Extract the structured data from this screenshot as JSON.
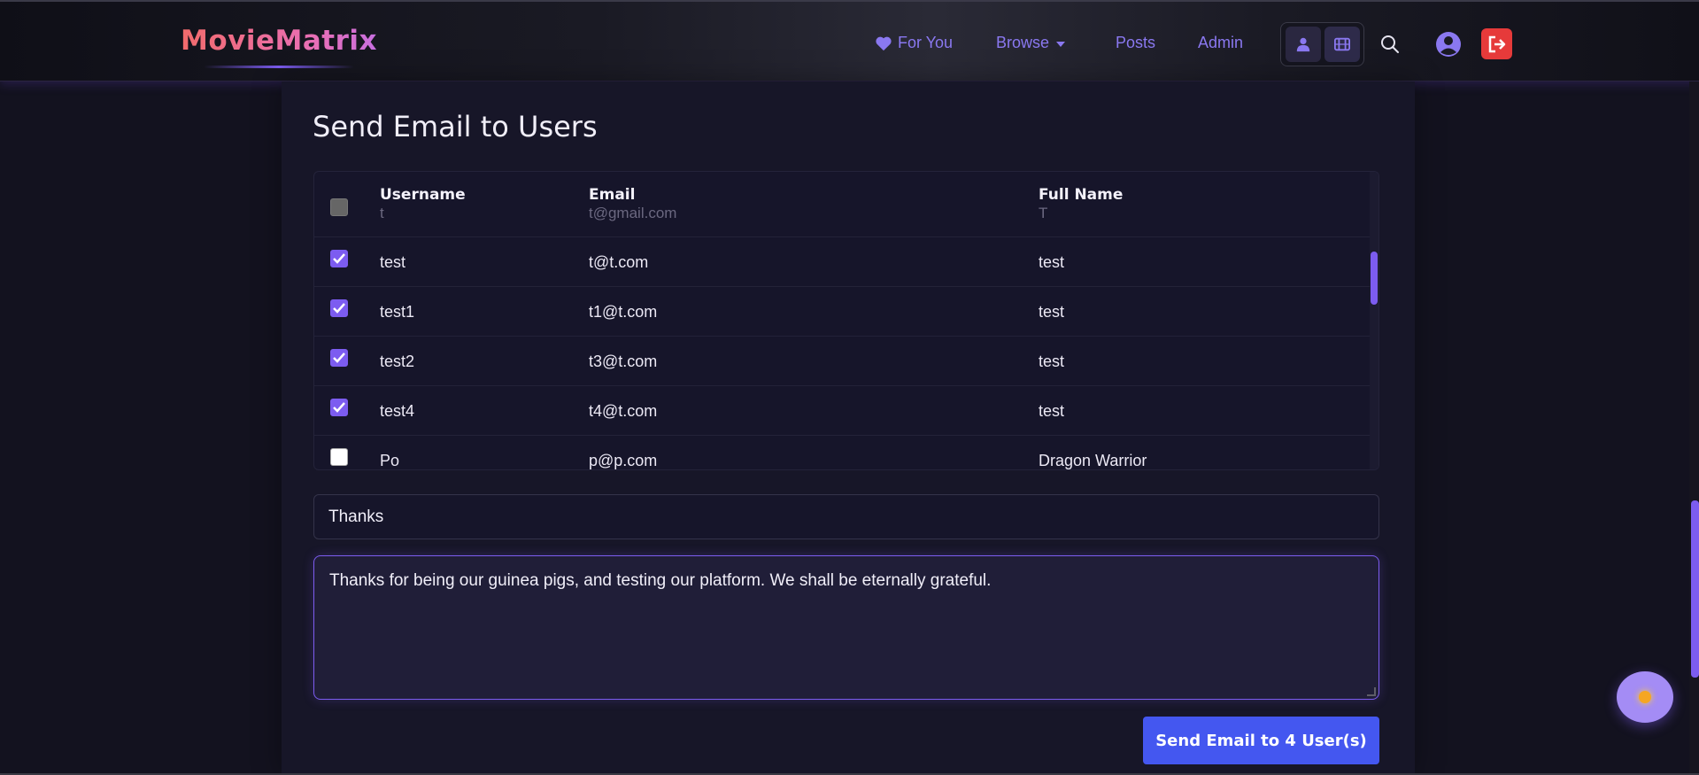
{
  "app": {
    "logo": "MovieMatrix"
  },
  "nav": {
    "for_you": "For You",
    "browse": "Browse",
    "posts": "Posts",
    "admin": "Admin"
  },
  "page": {
    "title": "Send Email to Users"
  },
  "table": {
    "headers": {
      "username": "Username",
      "email": "Email",
      "full_name": "Full Name"
    },
    "filters": {
      "username": "t",
      "email": "t@gmail.com",
      "full_name": "T"
    },
    "rows": [
      {
        "checked": true,
        "username": "test",
        "email": "t@t.com",
        "full_name": "test"
      },
      {
        "checked": true,
        "username": "test1",
        "email": "t1@t.com",
        "full_name": "test"
      },
      {
        "checked": true,
        "username": "test2",
        "email": "t3@t.com",
        "full_name": "test"
      },
      {
        "checked": true,
        "username": "test4",
        "email": "t4@t.com",
        "full_name": "test"
      },
      {
        "checked": false,
        "username": "Po",
        "email": "p@p.com",
        "full_name": "Dragon Warrior"
      }
    ]
  },
  "form": {
    "subject": "Thanks",
    "message": "Thanks for being our guinea pigs, and testing our platform. We shall be eternally grateful.",
    "send_label": "Send Email to 4 User(s)"
  },
  "colors": {
    "accent": "#7c5cf0",
    "send_button": "#4457f0",
    "logout": "#e63a3a",
    "background": "#13121f"
  },
  "icons": {
    "nav_for_you": "heart-icon",
    "toggle_user": "user-icon",
    "toggle_film": "film-icon",
    "search": "search-icon",
    "profile": "profile-icon",
    "logout": "logout-icon",
    "theme": "sun-icon"
  }
}
